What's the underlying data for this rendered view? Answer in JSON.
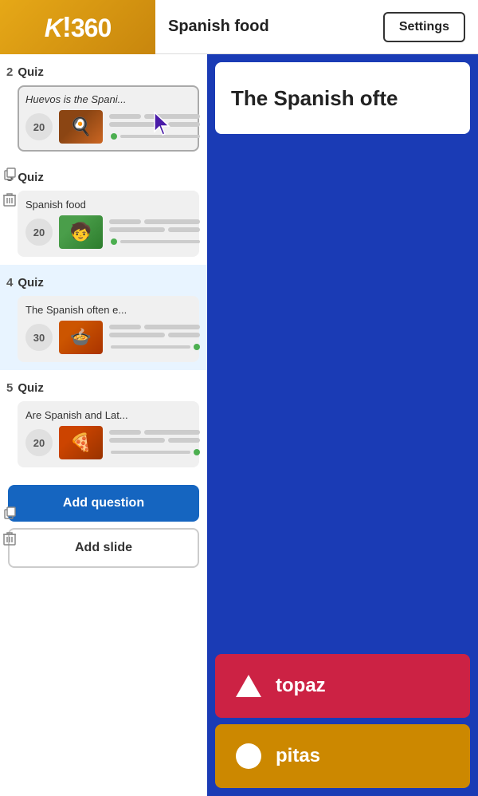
{
  "header": {
    "logo": "K!360",
    "title": "Spanish food",
    "settings_label": "Settings"
  },
  "sidebar": {
    "sections": [
      {
        "num": "2",
        "type": "Quiz",
        "card_title": "Huevos is the Spani...",
        "title_italic": true,
        "points": "20",
        "selected": true,
        "thumb_class": "quiz-thumb-2",
        "thumb_icon": "🍳"
      },
      {
        "num": "3",
        "type": "Quiz",
        "card_title": "Spanish food",
        "title_italic": false,
        "points": "20",
        "selected": false,
        "thumb_class": "quiz-thumb-3",
        "thumb_icon": "🧒"
      },
      {
        "num": "4",
        "type": "Quiz",
        "card_title": "The Spanish often e...",
        "title_italic": false,
        "points": "30",
        "selected": false,
        "thumb_class": "quiz-thumb-4",
        "thumb_icon": "🍲",
        "active": true
      },
      {
        "num": "5",
        "type": "Quiz",
        "card_title": "Are Spanish and Lat...",
        "title_italic": false,
        "points": "20",
        "selected": false,
        "thumb_class": "quiz-thumb-5",
        "thumb_icon": "🍕"
      }
    ],
    "add_question_label": "Add question",
    "add_slide_label": "Add slide"
  },
  "main": {
    "question_text": "The Spanish ofte",
    "answers": [
      {
        "shape": "triangle",
        "color_class": "answer-card-red",
        "text": "topaz"
      },
      {
        "shape": "circle",
        "color_class": "answer-card-gold",
        "text": "pitas"
      }
    ]
  }
}
